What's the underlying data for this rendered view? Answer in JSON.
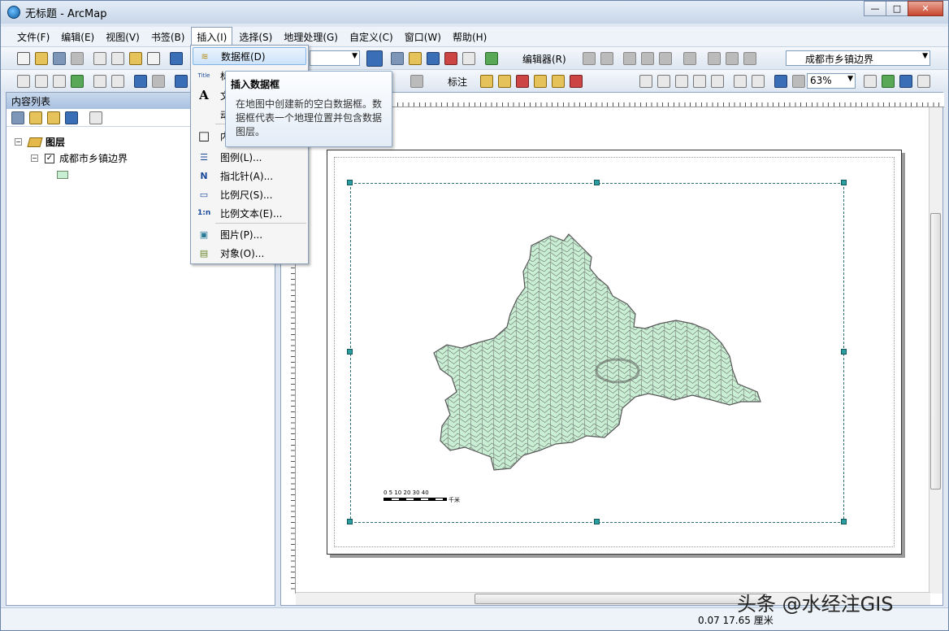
{
  "window": {
    "title": "无标题 - ArcMap",
    "buttons": {
      "minimize": "—",
      "maximize": "□",
      "close": "✕"
    }
  },
  "menubar": [
    {
      "label": "文件(F)"
    },
    {
      "label": "编辑(E)"
    },
    {
      "label": "视图(V)"
    },
    {
      "label": "书签(B)"
    },
    {
      "label": "插入(I)",
      "active": true
    },
    {
      "label": "选择(S)"
    },
    {
      "label": "地理处理(G)"
    },
    {
      "label": "自定义(C)"
    },
    {
      "label": "窗口(W)"
    },
    {
      "label": "帮助(H)"
    }
  ],
  "toolbar1": {
    "editor_label": "编辑器(R)",
    "target_layer": "成都市乡镇边界"
  },
  "toolbar2": {
    "label_menu": "标注",
    "zoom_level": "63%"
  },
  "toc": {
    "header": "内容列表",
    "group": "图层",
    "layer": "成都市乡镇边界",
    "layer_checked": "✓"
  },
  "insert_menu": {
    "items": [
      {
        "icon": "data-frame-icon",
        "glyph": "≋",
        "label": "数据框(D)",
        "highlight": true
      },
      {
        "icon": "title-icon",
        "glyph": "Title",
        "label": "标"
      },
      {
        "icon": "text-icon",
        "glyph": "A",
        "label": "文"
      },
      {
        "icon": "dynamic-text-icon",
        "glyph": "",
        "label": "动"
      },
      {
        "icon": "neatline-icon",
        "glyph": "□",
        "label": "内"
      },
      {
        "icon": "legend-icon",
        "glyph": "☰",
        "label": "图例(L)..."
      },
      {
        "icon": "north-arrow-icon",
        "glyph": "N",
        "label": "指北针(A)..."
      },
      {
        "icon": "scale-bar-icon",
        "glyph": "▭",
        "label": "比例尺(S)..."
      },
      {
        "icon": "scale-text-icon",
        "glyph": "1:n",
        "label": "比例文本(E)..."
      },
      {
        "icon": "picture-icon",
        "glyph": "▣",
        "label": "图片(P)..."
      },
      {
        "icon": "object-icon",
        "glyph": "▤",
        "label": "对象(O)..."
      }
    ]
  },
  "tooltip": {
    "title": "插入数据框",
    "body": "在地图中创建新的空白数据框。数据框代表一个地理位置并包含数据图层。"
  },
  "layout": {
    "scalebar_ticks": "0 5 10    20    30    40",
    "scalebar_unit": "千米",
    "map_fill": "#c8eed3",
    "map_stroke": "#555555"
  },
  "status": {
    "coords": "0.07   17.65 厘米"
  },
  "watermark": "头条 @水经注GIS"
}
